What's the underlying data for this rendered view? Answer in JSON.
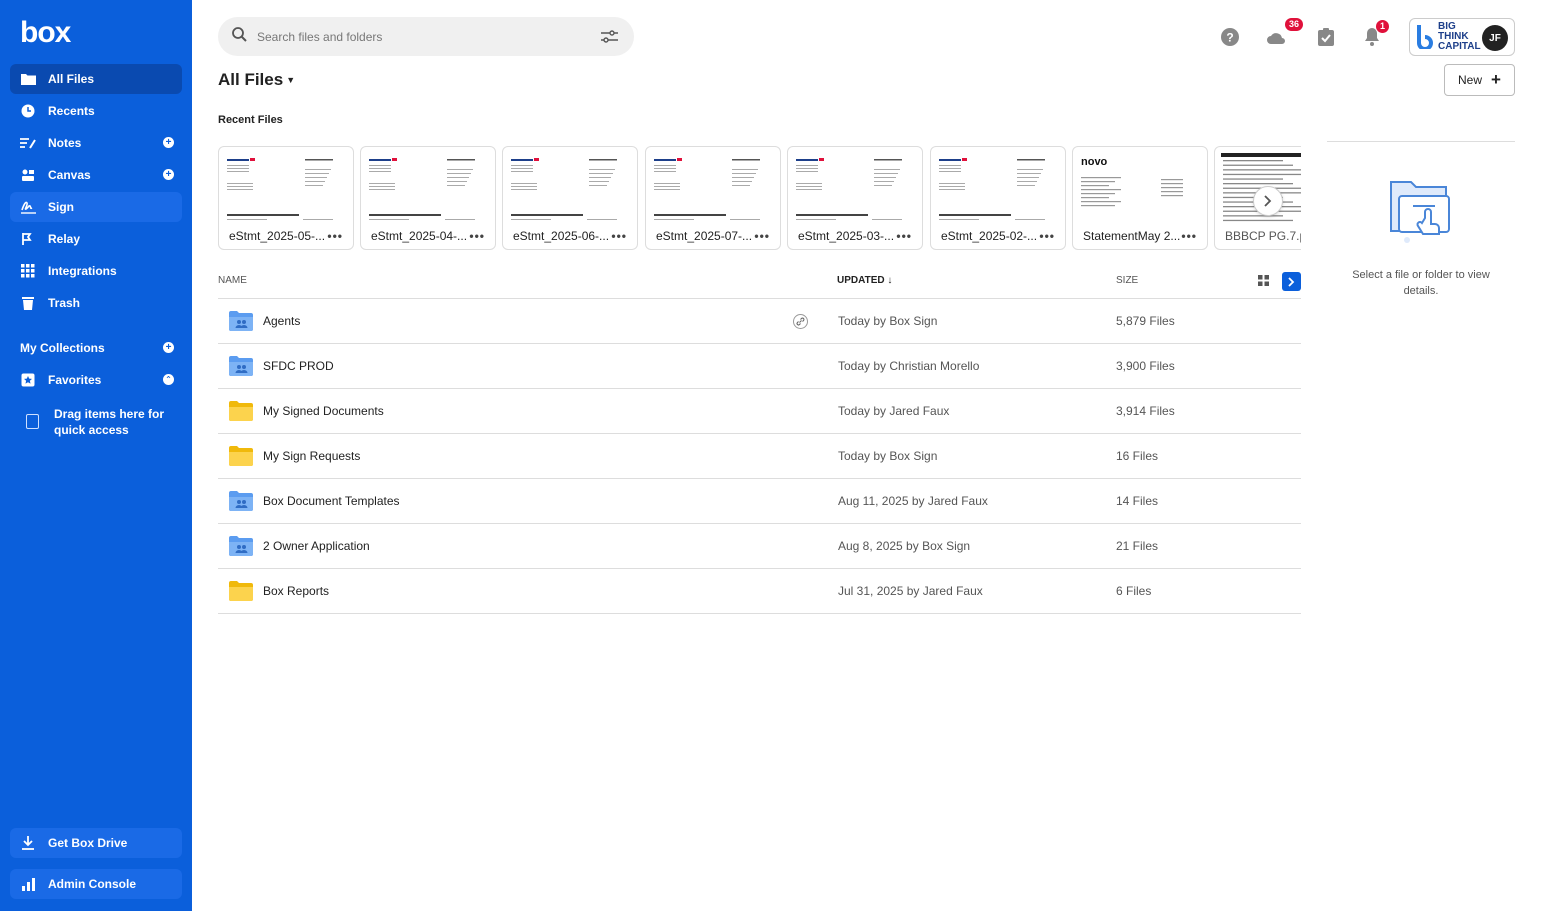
{
  "sidebar": {
    "logo": "box",
    "items": [
      {
        "label": "All Files",
        "icon": "folder-icon"
      },
      {
        "label": "Recents",
        "icon": "clock-icon"
      },
      {
        "label": "Notes",
        "icon": "notes-icon"
      },
      {
        "label": "Canvas",
        "icon": "canvas-icon"
      },
      {
        "label": "Sign",
        "icon": "sign-icon"
      },
      {
        "label": "Relay",
        "icon": "relay-icon"
      },
      {
        "label": "Integrations",
        "icon": "grid-icon"
      },
      {
        "label": "Trash",
        "icon": "trash-icon"
      }
    ],
    "collections_label": "My Collections",
    "favorites_label": "Favorites",
    "drag_hint": "Drag items here for quick access",
    "get_drive": "Get Box Drive",
    "admin_console": "Admin Console"
  },
  "search": {
    "placeholder": "Search files and folders"
  },
  "header": {
    "notifications_count": "36",
    "alerts_count": "1",
    "brand": "BIG THINK CAPITAL",
    "avatar_initials": "JF"
  },
  "page": {
    "title": "All Files",
    "new_button": "New"
  },
  "recent": {
    "title": "Recent Files",
    "files": [
      "eStmt_2025-05-...",
      "eStmt_2025-04-...",
      "eStmt_2025-06-...",
      "eStmt_2025-07-...",
      "eStmt_2025-03-...",
      "eStmt_2025-02-...",
      "StatementMay 2...",
      "BBBCP PG.7.p"
    ],
    "card_menu": "•••"
  },
  "table": {
    "headers": {
      "name": "NAME",
      "updated": "UPDATED",
      "size": "SIZE"
    },
    "rows": [
      {
        "name": "Agents",
        "updated": "Today by Box Sign",
        "size": "5,879 Files",
        "type": "shared"
      },
      {
        "name": "SFDC PROD",
        "updated": "Today by Christian Morello",
        "size": "3,900 Files",
        "type": "shared"
      },
      {
        "name": "My Signed Documents",
        "updated": "Today by Jared Faux",
        "size": "3,914 Files",
        "type": "personal"
      },
      {
        "name": "My Sign Requests",
        "updated": "Today by Box Sign",
        "size": "16 Files",
        "type": "personal"
      },
      {
        "name": "Box Document Templates",
        "updated": "Aug 11, 2025 by Jared Faux",
        "size": "14 Files",
        "type": "shared"
      },
      {
        "name": "2 Owner Application",
        "updated": "Aug 8, 2025 by Box Sign",
        "size": "21 Files",
        "type": "shared"
      },
      {
        "name": "Box Reports",
        "updated": "Jul 31, 2025 by Jared Faux",
        "size": "6 Files",
        "type": "personal"
      }
    ]
  },
  "details": {
    "empty_text": "Select a file or folder to view details."
  },
  "colors": {
    "sidebar": "#0b5fdb",
    "accent": "#0b5fdb",
    "badge": "#e0113b",
    "shared_folder": "#5b9cf0",
    "personal_folder": "#f5c518"
  }
}
